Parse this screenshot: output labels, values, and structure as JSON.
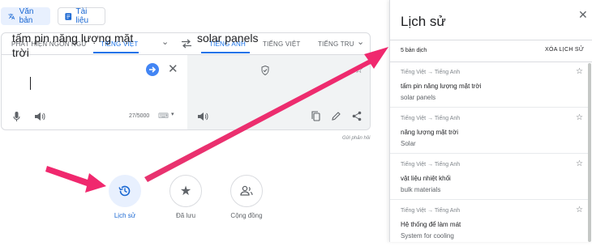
{
  "modes": {
    "text": "Văn bản",
    "docs": "Tài liệu"
  },
  "source_langs": [
    "PHÁT HIỆN NGÔN NGỮ",
    "TIẾNG VIỆT"
  ],
  "target_langs": [
    "TIẾNG ANH",
    "TIẾNG VIỆT",
    "TIẾNG TRU"
  ],
  "source_text": "tấm pin năng lượng mặt trời",
  "char_count": "27/5000",
  "target_text": "solar panels",
  "feedback": "Gửi phản hồi",
  "shortcuts": [
    {
      "label": "Lịch sử"
    },
    {
      "label": "Đã lưu"
    },
    {
      "label": "Cộng đồng"
    }
  ],
  "history": {
    "title": "Lịch sử",
    "count": "5 bản dịch",
    "clear": "XÓA LỊCH SỬ",
    "items": [
      {
        "pair": "Tiếng Việt → Tiếng Anh",
        "source": "tấm pin năng lượng mặt trời",
        "target": "solar panels"
      },
      {
        "pair": "Tiếng Việt → Tiếng Anh",
        "source": "năng lượng mặt trời",
        "target": "Solar"
      },
      {
        "pair": "Tiếng Việt → Tiếng Anh",
        "source": "vật liệu nhiệt khối",
        "target": "bulk materials"
      },
      {
        "pair": "Tiếng Việt → Tiếng Anh",
        "source": "Hệ thống để làm mát",
        "target": "System for cooling"
      }
    ]
  },
  "colors": {
    "accent": "#1a73e8",
    "arrow": "#f0286e"
  }
}
